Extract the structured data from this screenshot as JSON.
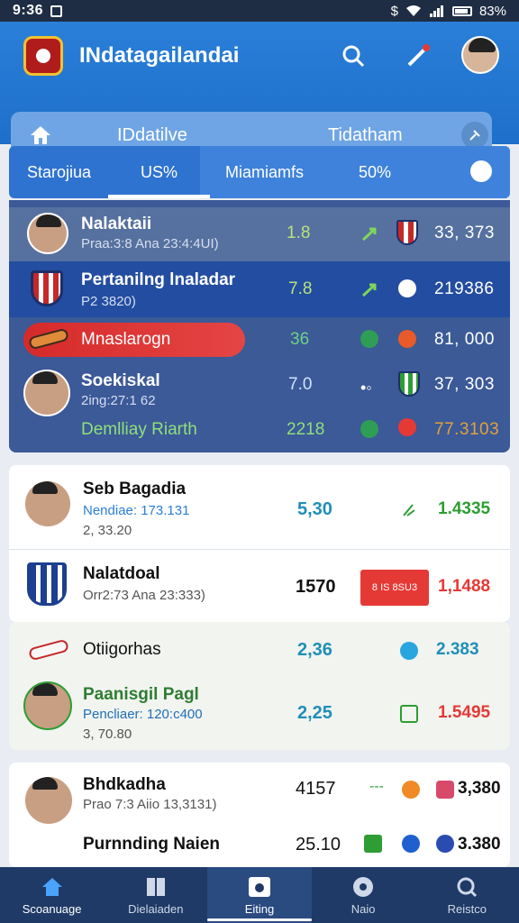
{
  "status": {
    "time": "9:36",
    "battery": "83%",
    "extra": "$"
  },
  "header": {
    "title": "INdatagailandai"
  },
  "subbar": {
    "left_label": "IDdatilve",
    "right_label": "Tidatham"
  },
  "tabs": [
    {
      "label": "Starojiua",
      "active": false
    },
    {
      "label": "US%",
      "active": true
    },
    {
      "label": "Miamiamfs",
      "active": false
    },
    {
      "label": "50%",
      "active": false
    }
  ],
  "live": {
    "rows": [
      {
        "name": "Nalaktaii",
        "sub": "Praa:3:8 Ana 23:4:4UI)",
        "num": "1.8",
        "value": "33, 373"
      },
      {
        "name": "Pertanilng lnaladar",
        "sub": "P2 3820)",
        "num": "7.8",
        "value": "219386"
      },
      {
        "name": "Mnaslarogn",
        "num": "36",
        "value": "81, 000"
      },
      {
        "name": "Soekiskal",
        "sub": "2ing:27:1 62",
        "num": "7.0",
        "value": "37, 303"
      },
      {
        "name": "Demlliay Riarth",
        "num": "2218",
        "value": "77.3103"
      }
    ]
  },
  "list": {
    "card1": [
      {
        "name": "Seb Bagadia",
        "sub": "Nendiae: 173.131",
        "sub2": "2, 33.20",
        "num": "5,30",
        "value": "1.4335"
      },
      {
        "name": "Nalatdoal",
        "sub": "Orr2:73 Ana 23:333)",
        "num": "1570",
        "badge": "8 IS 8SU3",
        "value": "1,1488"
      }
    ],
    "card2": [
      {
        "name": "Otiigorhas",
        "num": "2,36",
        "value": "2.383"
      },
      {
        "name": "Paanisgil Pagl",
        "sub": "Pencliaer: 120:c400",
        "sub2": "3, 70.80",
        "num": "2,25",
        "value": "1.5495"
      }
    ],
    "card3": [
      {
        "name": "Bhdkadha",
        "sub": "Prao 7:3 Aiio 13,3131)",
        "num": "4157",
        "dots": "---",
        "value": "3,380"
      },
      {
        "name": "Purnnding Naien",
        "num": "25.10",
        "value": "3.380"
      }
    ]
  },
  "nav": [
    {
      "label": "Scoanuage",
      "icon": "home-icon"
    },
    {
      "label": "Dielaiaden",
      "icon": "grid-icon"
    },
    {
      "label": "Eiting",
      "icon": "camera-icon"
    },
    {
      "label": "Naio",
      "icon": "ball-icon"
    },
    {
      "label": "Reistco",
      "icon": "search-icon"
    }
  ],
  "colors": {
    "primary": "#2a7fd8",
    "nav": "#1f3a66",
    "green": "#2e9d33",
    "red": "#e53935",
    "teal": "#1f8fb8"
  }
}
